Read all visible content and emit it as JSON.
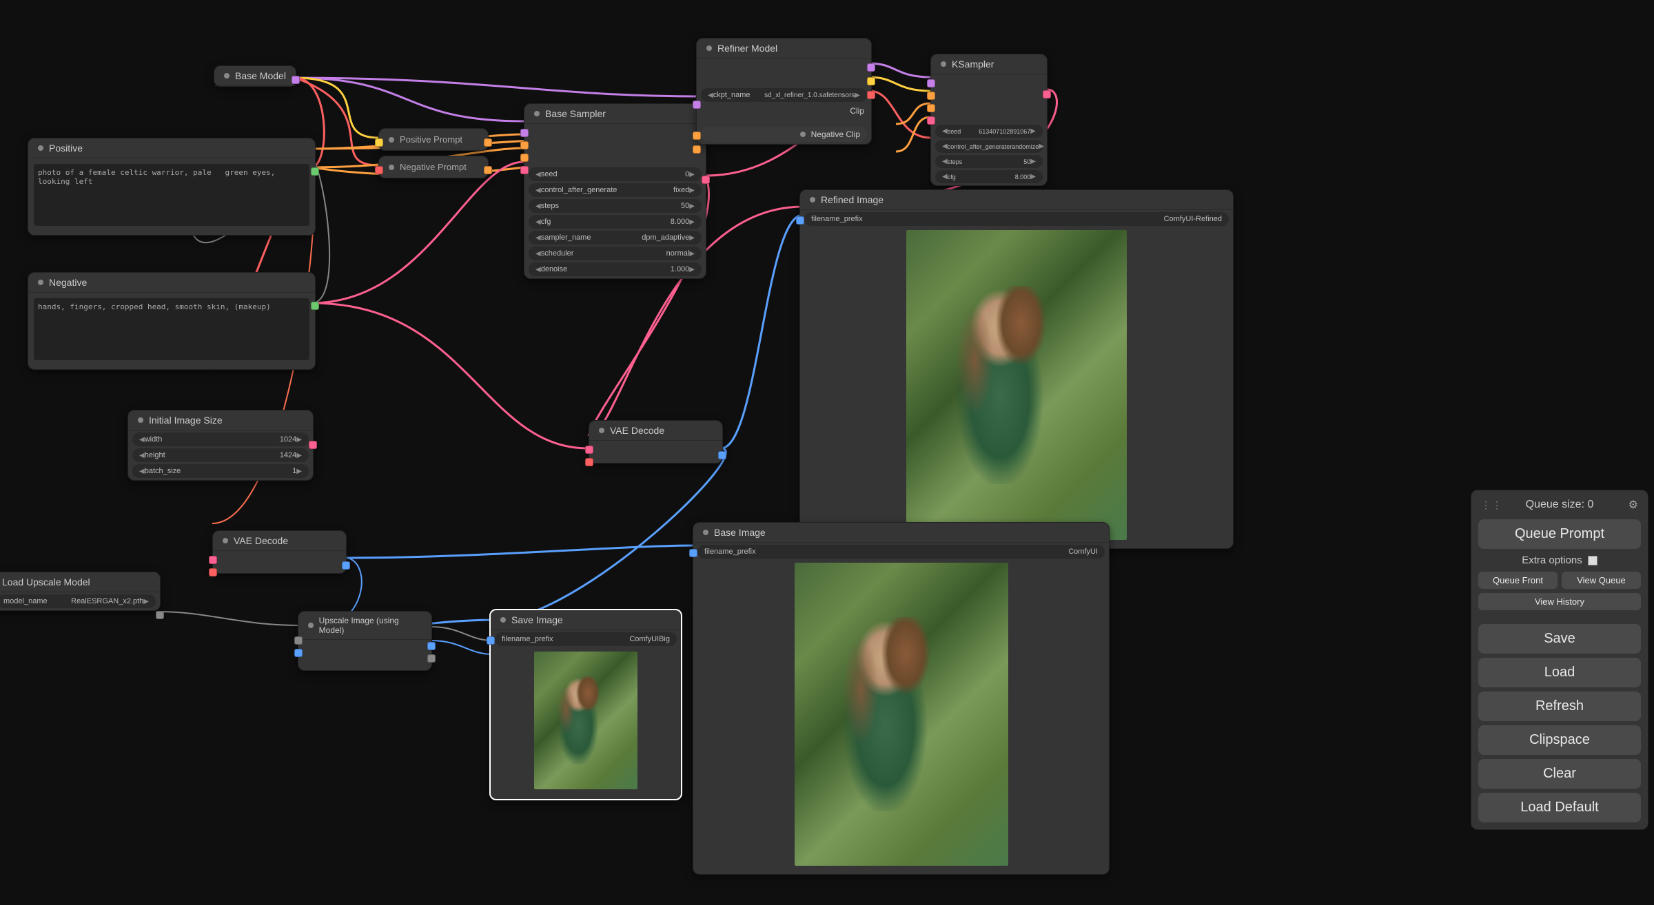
{
  "panel": {
    "queueSize": "Queue size: 0",
    "queuePrompt": "Queue Prompt",
    "extraOptions": "Extra options",
    "queueFront": "Queue Front",
    "viewQueue": "View Queue",
    "viewHistory": "View History",
    "save": "Save",
    "load": "Load",
    "refresh": "Refresh",
    "clipspace": "Clipspace",
    "clear": "Clear",
    "loadDefault": "Load Default"
  },
  "nodes": {
    "baseModel": {
      "title": "Base Model"
    },
    "positive": {
      "title": "Positive",
      "text": "photo of a female celtic warrior, pale   green eyes, looking left"
    },
    "negative": {
      "title": "Negative",
      "text": "hands, fingers, cropped head, smooth skin, (makeup)"
    },
    "positivePrompt": {
      "title": "Positive Prompt"
    },
    "negativePrompt": {
      "title": "Negative Prompt"
    },
    "initialSize": {
      "title": "Initial Image Size",
      "width": {
        "label": "width",
        "value": "1024"
      },
      "height": {
        "label": "height",
        "value": "1424"
      },
      "batch": {
        "label": "batch_size",
        "value": "1"
      }
    },
    "baseSampler": {
      "title": "Base Sampler",
      "seed": {
        "label": "seed",
        "value": "0"
      },
      "cag": {
        "label": "control_after_generate",
        "value": "fixed"
      },
      "steps": {
        "label": "steps",
        "value": "50"
      },
      "cfg": {
        "label": "cfg",
        "value": "8.000"
      },
      "sampler": {
        "label": "sampler_name",
        "value": "dpm_adaptive"
      },
      "scheduler": {
        "label": "scheduler",
        "value": "normal"
      },
      "denoise": {
        "label": "denoise",
        "value": "1.000"
      }
    },
    "refinerModel": {
      "title": "Refiner Model",
      "ckpt": {
        "label": "ckpt_name",
        "value": "sd_xl_refiner_1.0.safetensors"
      },
      "clip": "Clip",
      "negclip": "Negative Clip"
    },
    "ksampler": {
      "title": "KSampler",
      "seed": {
        "label": "seed",
        "value": "613407102891067"
      },
      "cag": {
        "label": "control_after_generate",
        "value": "randomize"
      },
      "steps": {
        "label": "steps",
        "value": "50"
      },
      "cfg": {
        "label": "cfg",
        "value": "8.000"
      }
    },
    "vaeDecode1": {
      "title": "VAE Decode"
    },
    "vaeDecode2": {
      "title": "VAE Decode"
    },
    "refinedImage": {
      "title": "Refined Image",
      "prefix": {
        "label": "filename_prefix",
        "value": "ComfyUI-Refined"
      }
    },
    "baseImage": {
      "title": "Base Image",
      "prefix": {
        "label": "filename_prefix",
        "value": "ComfyUI"
      }
    },
    "loadUpscale": {
      "title": "Load Upscale Model",
      "model": {
        "label": "model_name",
        "value": "RealESRGAN_x2.pth"
      }
    },
    "upscaleImage": {
      "title": "Upscale Image (using Model)"
    },
    "saveImage": {
      "title": "Save Image",
      "prefix": {
        "label": "filename_prefix",
        "value": "ComfyUIBig"
      }
    }
  }
}
